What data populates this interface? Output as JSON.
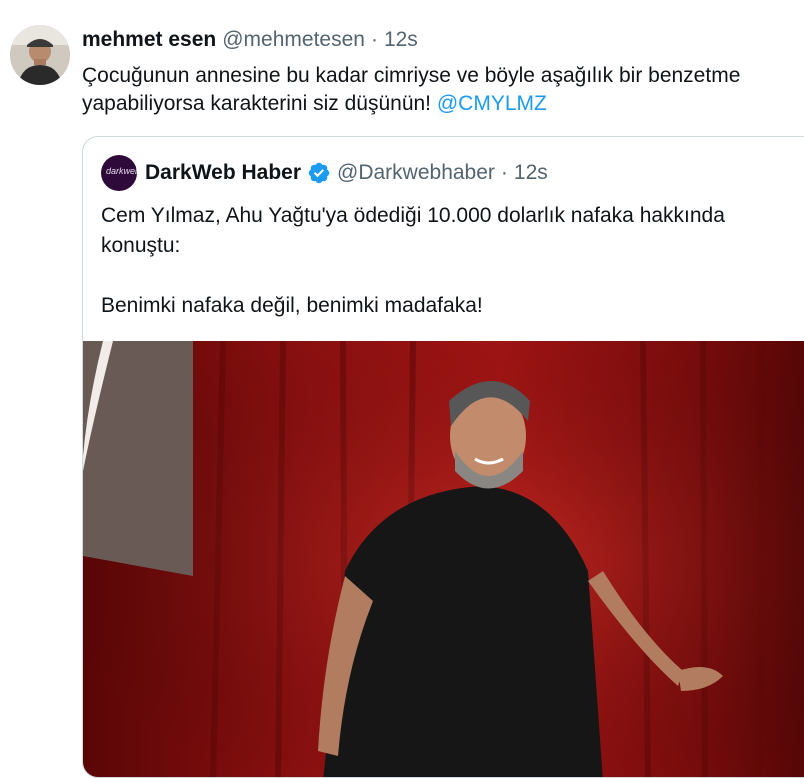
{
  "tweet": {
    "author_name": "mehmet esen",
    "author_handle": "@mehmetesen",
    "separator": "·",
    "time": "12s",
    "text_line1": "Çocuğunun annesine bu kadar cimriyse ve böyle aşağılık bir benzetme",
    "text_line2": "yapabiliyorsa karakterini siz düşünün!",
    "mention": "@CMYLMZ"
  },
  "quote": {
    "avatar_text": "darkweb",
    "author_name": "DarkWeb Haber",
    "author_handle": "@Darkwebhaber",
    "separator": "·",
    "time": "12s",
    "paragraph1": "Cem Yılmaz, Ahu Yağtu'ya ödediği 10.000 dolarlık nafaka hakkında konuştu:",
    "paragraph2": "Benimki nafaka değil, benimki madafaka!"
  },
  "colors": {
    "link": "#1d9bf0",
    "verified": "#1d9bf0",
    "muted": "#536471",
    "border": "#cfd9de"
  },
  "icons": {
    "verified": "verified-badge-icon"
  }
}
